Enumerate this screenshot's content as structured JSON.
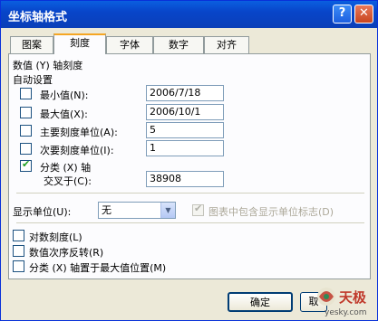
{
  "window": {
    "title": "坐标轴格式",
    "help_glyph": "?",
    "close_glyph": "✕"
  },
  "tabs": [
    {
      "label": "图案",
      "active": false
    },
    {
      "label": "刻度",
      "active": true
    },
    {
      "label": "字体",
      "active": false
    },
    {
      "label": "数字",
      "active": false
    },
    {
      "label": "对齐",
      "active": false
    }
  ],
  "scale": {
    "heading": "数值 (Y) 轴刻度",
    "auto_heading": "自动设置",
    "min_label": "最小值(N):",
    "min_value": "2006/7/18",
    "max_label": "最大值(X):",
    "max_value": "2006/10/1",
    "major_label": "主要刻度单位(A):",
    "major_value": "5",
    "minor_label": "次要刻度单位(I):",
    "minor_value": "1",
    "category_label": "分类 (X) 轴",
    "cross_label": "交叉于(C):",
    "cross_value": "38908"
  },
  "display_units": {
    "label": "显示单位(U):",
    "value": "无",
    "show_label_text": "图表中包含显示单位标志(D)"
  },
  "options": {
    "log_scale": "对数刻度(L)",
    "reverse": "数值次序反转(R)",
    "cross_at_max": "分类 (X) 轴置于最大值位置(M)"
  },
  "footer": {
    "ok_label": "确定",
    "cancel_label": "取"
  },
  "watermark": {
    "brand": "天极",
    "site": "yesky.com"
  },
  "colors": {
    "title_bar": "#0a4fd6",
    "dialog_bg": "#ece9d8",
    "panel_bg": "#fcfcfe",
    "active_tab_accent": "#f5a623"
  }
}
